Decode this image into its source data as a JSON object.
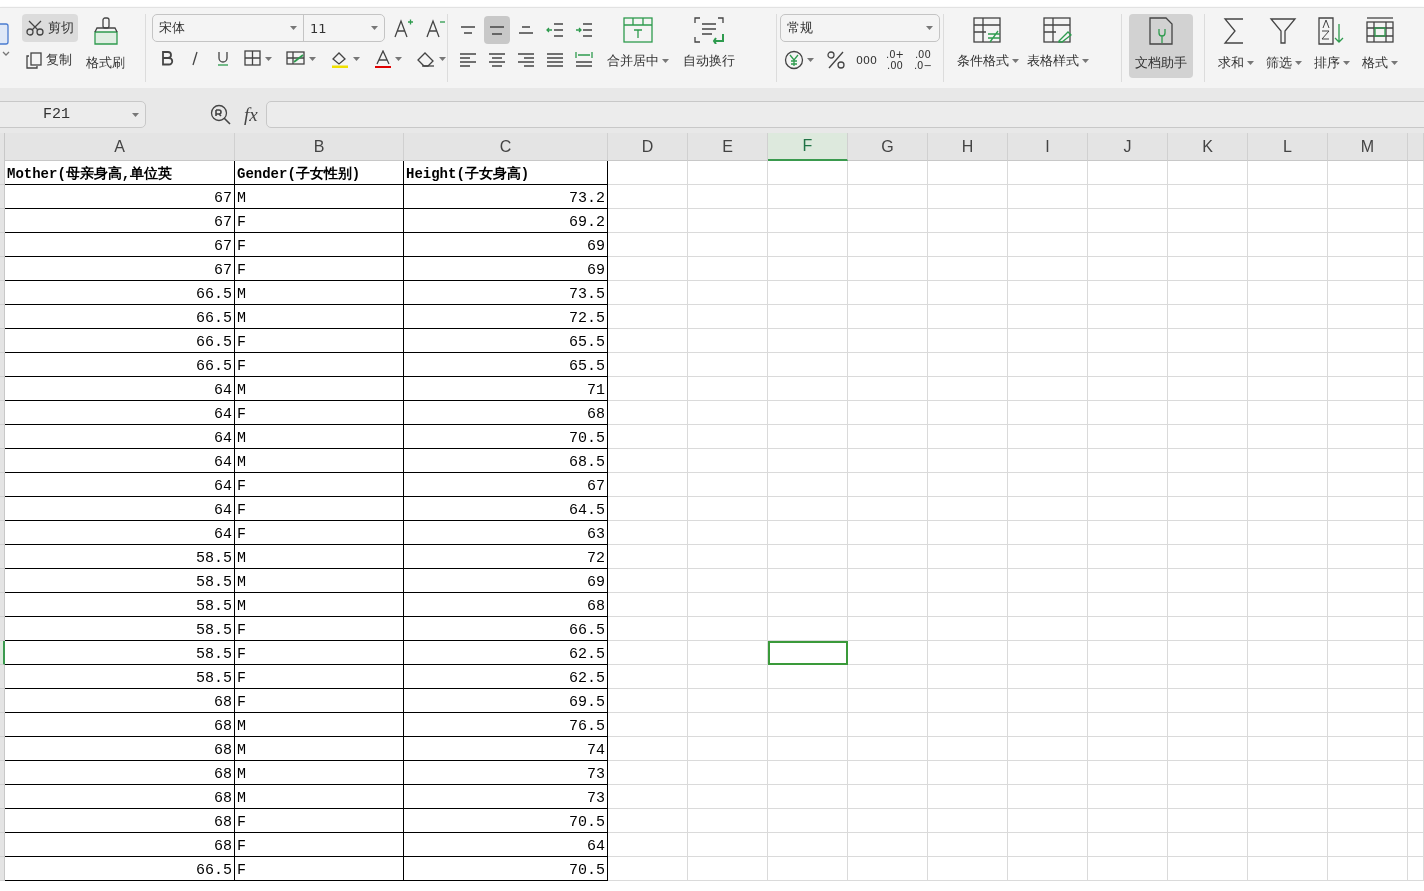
{
  "ribbon": {
    "clipboard": {
      "cut": {
        "label": "剪切",
        "selected": true
      },
      "copy": {
        "label": "复制"
      },
      "format_painter": {
        "label": "格式刷"
      }
    },
    "font": {
      "name": "宋体",
      "size": "11"
    },
    "alignment": {
      "buttons": [
        {
          "kind": "top",
          "selected": false
        },
        {
          "kind": "middle",
          "selected": true
        },
        {
          "kind": "bottom",
          "selected": false
        },
        {
          "kind": "outdent",
          "selected": false
        },
        {
          "kind": "indent",
          "selected": false
        },
        {
          "kind": "left",
          "selected": false
        },
        {
          "kind": "center",
          "selected": false
        },
        {
          "kind": "right",
          "selected": false
        },
        {
          "kind": "justify",
          "selected": false
        },
        {
          "kind": "distribute",
          "selected": false
        }
      ],
      "merge": {
        "label": "合并居中"
      },
      "wrap": {
        "label": "自动换行"
      }
    },
    "number": {
      "format": "常规",
      "thousands": "000",
      "decimals": [
        {
          "lines": [
            ".0+",
            ".00"
          ]
        },
        {
          "lines": [
            ".00",
            ".0−"
          ]
        }
      ]
    },
    "styles": [
      {
        "kind": "conditional",
        "label": "条件格式"
      },
      {
        "kind": "table",
        "label": "表格样式"
      }
    ],
    "assistant": {
      "label": "文档助手",
      "selected": true
    },
    "tools": [
      {
        "kind": "sum",
        "label": "求和"
      },
      {
        "kind": "filter",
        "label": "筛选"
      },
      {
        "kind": "sort",
        "label": "排序"
      },
      {
        "kind": "format",
        "label": "格式"
      }
    ]
  },
  "formula_bar": {
    "name_box": "F21",
    "fx": "fx"
  },
  "sheet": {
    "columns": [
      {
        "label": "A",
        "selected": false
      },
      {
        "label": "B",
        "selected": false
      },
      {
        "label": "C",
        "selected": false
      },
      {
        "label": "D",
        "selected": false
      },
      {
        "label": "E",
        "selected": false
      },
      {
        "label": "F",
        "selected": true
      },
      {
        "label": "G",
        "selected": false
      },
      {
        "label": "H",
        "selected": false
      },
      {
        "label": "I",
        "selected": false
      },
      {
        "label": "J",
        "selected": false
      },
      {
        "label": "K",
        "selected": false
      },
      {
        "label": "L",
        "selected": false
      },
      {
        "label": "M",
        "selected": false
      }
    ],
    "header": [
      "Mother(母亲身高,单位英",
      "Gender(子女性别)",
      "Height(子女身高)"
    ],
    "rows": [
      {
        "cells": [
          "67",
          "M",
          "73.2"
        ],
        "selected": false
      },
      {
        "cells": [
          "67",
          "F",
          "69.2"
        ],
        "selected": false
      },
      {
        "cells": [
          "67",
          "F",
          "69"
        ],
        "selected": false
      },
      {
        "cells": [
          "67",
          "F",
          "69"
        ],
        "selected": false
      },
      {
        "cells": [
          "66.5",
          "M",
          "73.5"
        ],
        "selected": false
      },
      {
        "cells": [
          "66.5",
          "M",
          "72.5"
        ],
        "selected": false
      },
      {
        "cells": [
          "66.5",
          "F",
          "65.5"
        ],
        "selected": false
      },
      {
        "cells": [
          "66.5",
          "F",
          "65.5"
        ],
        "selected": false
      },
      {
        "cells": [
          "64",
          "M",
          "71"
        ],
        "selected": false
      },
      {
        "cells": [
          "64",
          "F",
          "68"
        ],
        "selected": false
      },
      {
        "cells": [
          "64",
          "M",
          "70.5"
        ],
        "selected": false
      },
      {
        "cells": [
          "64",
          "M",
          "68.5"
        ],
        "selected": false
      },
      {
        "cells": [
          "64",
          "F",
          "67"
        ],
        "selected": false
      },
      {
        "cells": [
          "64",
          "F",
          "64.5"
        ],
        "selected": false
      },
      {
        "cells": [
          "64",
          "F",
          "63"
        ],
        "selected": false
      },
      {
        "cells": [
          "58.5",
          "M",
          "72"
        ],
        "selected": false
      },
      {
        "cells": [
          "58.5",
          "M",
          "69"
        ],
        "selected": false
      },
      {
        "cells": [
          "58.5",
          "M",
          "68"
        ],
        "selected": false
      },
      {
        "cells": [
          "58.5",
          "F",
          "66.5"
        ],
        "selected": false
      },
      {
        "cells": [
          "58.5",
          "F",
          "62.5"
        ],
        "selected": true
      },
      {
        "cells": [
          "58.5",
          "F",
          "62.5"
        ],
        "selected": false
      },
      {
        "cells": [
          "68",
          "F",
          "69.5"
        ],
        "selected": false
      },
      {
        "cells": [
          "68",
          "M",
          "76.5"
        ],
        "selected": false
      },
      {
        "cells": [
          "68",
          "M",
          "74"
        ],
        "selected": false
      },
      {
        "cells": [
          "68",
          "M",
          "73"
        ],
        "selected": false
      },
      {
        "cells": [
          "68",
          "M",
          "73"
        ],
        "selected": false
      },
      {
        "cells": [
          "68",
          "F",
          "70.5"
        ],
        "selected": false
      },
      {
        "cells": [
          "68",
          "F",
          "64"
        ],
        "selected": false
      },
      {
        "cells": [
          "66.5",
          "F",
          "70.5"
        ],
        "selected": false
      }
    ]
  }
}
